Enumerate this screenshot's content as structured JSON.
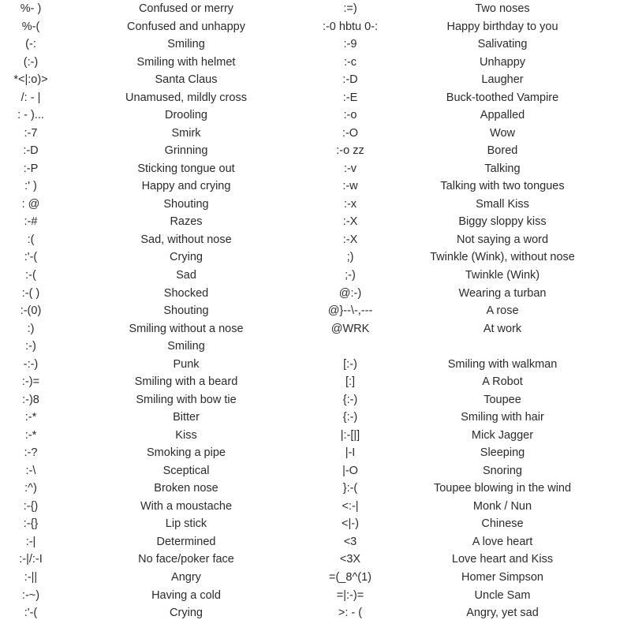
{
  "page": {
    "title": "Emoticon Reference Table",
    "background_color": "#ffffff",
    "text_color": "#2b2b2b",
    "columns": 2,
    "row_count": 35
  },
  "columns": [
    {
      "name": "left-column",
      "rows": [
        {
          "code": "%- )",
          "desc": "Confused or merry"
        },
        {
          "code": "%-(",
          "desc": "Confused and unhappy"
        },
        {
          "code": "(-:",
          "desc": "Smiling"
        },
        {
          "code": "(:-)",
          "desc": "Smiling with helmet"
        },
        {
          "code": "*<|:o)>",
          "desc": "Santa Claus"
        },
        {
          "code": "/: - |",
          "desc": "Unamused, mildly cross"
        },
        {
          "code": ": - )...",
          "desc": "Drooling"
        },
        {
          "code": ":-7",
          "desc": "Smirk"
        },
        {
          "code": ":-D",
          "desc": "Grinning"
        },
        {
          "code": ":-P",
          "desc": "Sticking tongue out"
        },
        {
          "code": ":' )",
          "desc": "Happy and crying"
        },
        {
          "code": ": @",
          "desc": "Shouting"
        },
        {
          "code": ":-#",
          "desc": "Razes"
        },
        {
          "code": ":(",
          "desc": "Sad, without nose"
        },
        {
          "code": ":'-(",
          "desc": "Crying"
        },
        {
          "code": ":-(",
          "desc": "Sad"
        },
        {
          "code": ":-( )",
          "desc": "Shocked"
        },
        {
          "code": ":-(0)",
          "desc": "Shouting"
        },
        {
          "code": ":)",
          "desc": "Smiling without a nose"
        },
        {
          "code": ":-)",
          "desc": "Smiling"
        },
        {
          "code": "-:-)",
          "desc": "Punk"
        },
        {
          "code": ":-)=",
          "desc": "Smiling with a beard"
        },
        {
          "code": ":-)8",
          "desc": "Smiling with bow tie"
        },
        {
          "code": ":-*",
          "desc": "Bitter"
        },
        {
          "code": ":-*",
          "desc": "Kiss"
        },
        {
          "code": ":-?",
          "desc": "Smoking a pipe"
        },
        {
          "code": ":-\\",
          "desc": "Sceptical"
        },
        {
          "code": ":^)",
          "desc": "Broken nose"
        },
        {
          "code": ":-{)",
          "desc": "With a moustache"
        },
        {
          "code": ":-{}",
          "desc": "Lip stick"
        },
        {
          "code": ":-|",
          "desc": "Determined"
        },
        {
          "code": ":-|/:-I",
          "desc": "No face/poker face"
        },
        {
          "code": ":-||",
          "desc": "Angry"
        },
        {
          "code": ":-~)",
          "desc": "Having a cold"
        },
        {
          "code": ":'-(",
          "desc": "Crying"
        }
      ]
    },
    {
      "name": "right-column",
      "rows": [
        {
          "code": ":=)",
          "desc": "Two noses"
        },
        {
          "code": ":-0 hbtu 0-:",
          "desc": "Happy birthday to you"
        },
        {
          "code": ":-9",
          "desc": "Salivating"
        },
        {
          "code": ":-c",
          "desc": "Unhappy"
        },
        {
          "code": ":-D",
          "desc": "Laugher"
        },
        {
          "code": ":-E",
          "desc": "Buck-toothed Vampire"
        },
        {
          "code": ":-o",
          "desc": "Appalled"
        },
        {
          "code": ":-O",
          "desc": "Wow"
        },
        {
          "code": ":-o zz",
          "desc": "Bored"
        },
        {
          "code": ":-v",
          "desc": "Talking"
        },
        {
          "code": ":-w",
          "desc": "Talking with two tongues"
        },
        {
          "code": ":-x",
          "desc": "Small Kiss"
        },
        {
          "code": ":-X",
          "desc": "Biggy sloppy kiss"
        },
        {
          "code": ":-X",
          "desc": "Not saying a word"
        },
        {
          "code": ";)",
          "desc": "Twinkle (Wink), without nose"
        },
        {
          "code": ";-)",
          "desc": "Twinkle (Wink)"
        },
        {
          "code": "@:-)",
          "desc": "Wearing a turban"
        },
        {
          "code": "@}--\\-,---",
          "desc": "A rose"
        },
        {
          "code": "@WRK",
          "desc": "At work"
        },
        {
          "code": "",
          "desc": ""
        },
        {
          "code": "[:-)",
          "desc": "Smiling with walkman"
        },
        {
          "code": "[:]",
          "desc": "A Robot"
        },
        {
          "code": "{:-)",
          "desc": "Toupee"
        },
        {
          "code": "{:-)",
          "desc": "Smiling with hair"
        },
        {
          "code": "|:-[|]",
          "desc": "Mick Jagger"
        },
        {
          "code": "|-I",
          "desc": "Sleeping"
        },
        {
          "code": "|-O",
          "desc": "Snoring"
        },
        {
          "code": "}:-(",
          "desc": "Toupee blowing in the wind"
        },
        {
          "code": "<:-|",
          "desc": "Monk / Nun"
        },
        {
          "code": "<|-)",
          "desc": "Chinese"
        },
        {
          "code": "<3",
          "desc": "A love heart"
        },
        {
          "code": "<3X",
          "desc": "Love heart and Kiss"
        },
        {
          "code": "=(_8^(1)",
          "desc": "Homer Simpson"
        },
        {
          "code": "=|:-)=",
          "desc": "Uncle Sam"
        },
        {
          "code": ">: - (",
          "desc": "Angry, yet sad"
        }
      ]
    }
  ]
}
